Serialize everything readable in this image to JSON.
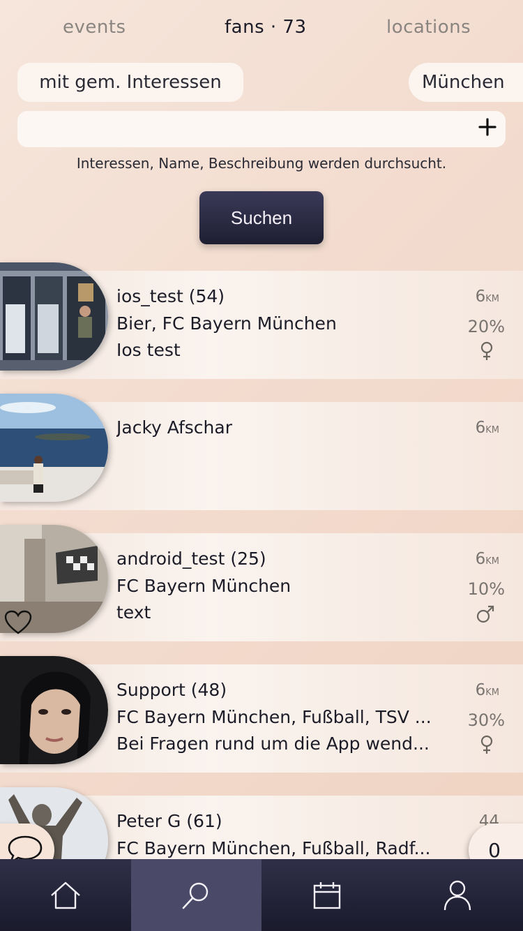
{
  "tabs": {
    "events": "events",
    "fans": "fans · 73",
    "locations": "locations"
  },
  "filters": {
    "interests": "mit gem. Interessen",
    "city": "München"
  },
  "search": {
    "value": "",
    "placeholder": "",
    "hint": "Interessen, Name, Beschreibung werden durchsucht.",
    "button_label": "Suchen"
  },
  "results": [
    {
      "name": "ios_test (54)",
      "interests": "Bier, FC Bayern München",
      "description": "Ios test",
      "distance": "6",
      "unit": "KM",
      "match": "20%",
      "gender": "female",
      "favorite": false
    },
    {
      "name": "Jacky Afschar",
      "interests": "",
      "description": "",
      "distance": "6",
      "unit": "KM",
      "match": "",
      "gender": "",
      "favorite": false
    },
    {
      "name": "android_test (25)",
      "interests": "FC Bayern München",
      "description": "text",
      "distance": "6",
      "unit": "KM",
      "match": "10%",
      "gender": "male",
      "favorite": true
    },
    {
      "name": "Support (48)",
      "interests": "FC Bayern München, Fußball, TSV ...",
      "description": "Bei Fragen rund um die App wend...",
      "distance": "6",
      "unit": "KM",
      "match": "30%",
      "gender": "female",
      "favorite": false
    },
    {
      "name": "Peter G (61)",
      "interests": "FC Bayern München, Fußball, Radf...",
      "description": "",
      "distance": "44",
      "unit": "",
      "match": "",
      "gender": "",
      "favorite": false
    }
  ],
  "fabs": {
    "chat_icon": "speech-bubble-icon",
    "unread_count": "0"
  },
  "nav": {
    "items": [
      "home-icon",
      "search-icon",
      "calendar-icon",
      "profile-icon"
    ],
    "active": "search-icon"
  },
  "colors": {
    "nav_bg": "#1e1e32",
    "nav_active": "#4a4a68",
    "accent_button": "#2a2a44",
    "bg": "#f3dccf"
  }
}
